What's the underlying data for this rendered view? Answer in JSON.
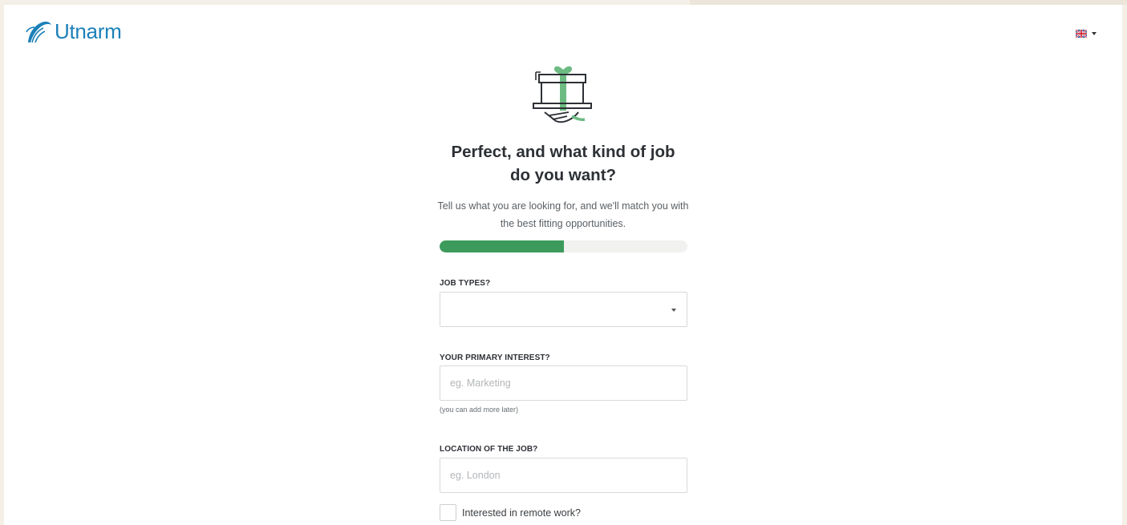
{
  "brand": {
    "name": "Utnarm",
    "logo_icon": "wing-icon",
    "color": "#1c80b8"
  },
  "language": {
    "flag_icon": "uk-flag-icon"
  },
  "header": {
    "illustration_icon": "gift-on-hand-icon",
    "title": "Perfect, and what kind of job do you want?",
    "subtitle": "Tell us what you are looking for, and we'll match you with the best fitting opportunities."
  },
  "progress": {
    "value": 0.5,
    "color": "#3c9b5b"
  },
  "form": {
    "job_types": {
      "label": "JOB TYPES?",
      "value": ""
    },
    "primary_interest": {
      "label": "YOUR PRIMARY INTEREST?",
      "placeholder": "eg. Marketing",
      "hint": "(you can add more later)"
    },
    "location": {
      "label": "LOCATION OF THE JOB?",
      "placeholder": "eg. London"
    },
    "remote": {
      "label": "Interested in remote work?",
      "checked": false
    }
  }
}
